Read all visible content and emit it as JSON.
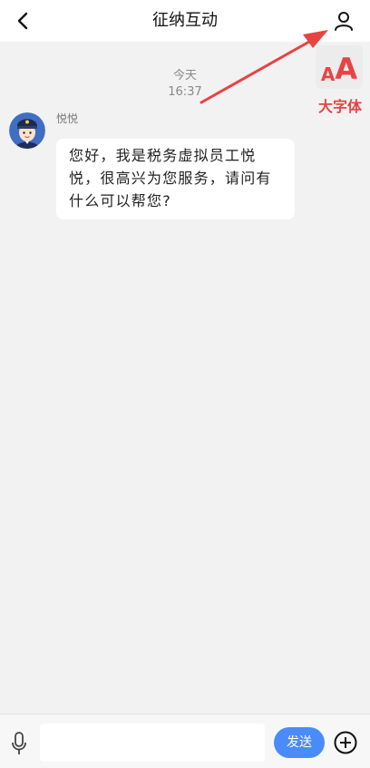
{
  "header": {
    "title": "征纳互动",
    "back_icon": "chevron-left-icon",
    "profile_icon": "user-profile-icon"
  },
  "font_size_toggle": {
    "small_glyph": "A",
    "large_glyph": "A",
    "label": "大字体",
    "color": "#e84343"
  },
  "chat": {
    "date_label": "今天",
    "time_label": "16:37",
    "messages": [
      {
        "sender": "悦悦",
        "avatar_icon": "agent-avatar-icon",
        "text": "您好，我是税务虚拟员工悦悦，很高兴为您服务，请问有什么可以帮您?"
      }
    ]
  },
  "footer": {
    "mic_icon": "microphone-icon",
    "input_value": "",
    "input_placeholder": "",
    "send_label": "发送",
    "plus_icon": "plus-circle-icon",
    "send_color": "#4a8cf7"
  }
}
